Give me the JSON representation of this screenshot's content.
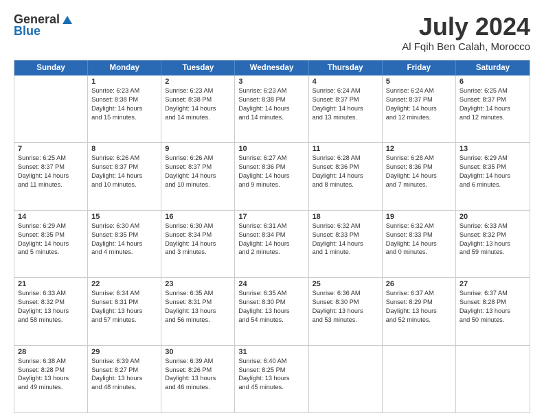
{
  "header": {
    "logo_general": "General",
    "logo_blue": "Blue",
    "title": "July 2024",
    "location": "Al Fqih Ben Calah, Morocco"
  },
  "calendar": {
    "days_of_week": [
      "Sunday",
      "Monday",
      "Tuesday",
      "Wednesday",
      "Thursday",
      "Friday",
      "Saturday"
    ],
    "rows": [
      [
        {
          "day": "",
          "text": ""
        },
        {
          "day": "1",
          "text": "Sunrise: 6:23 AM\nSunset: 8:38 PM\nDaylight: 14 hours\nand 15 minutes."
        },
        {
          "day": "2",
          "text": "Sunrise: 6:23 AM\nSunset: 8:38 PM\nDaylight: 14 hours\nand 14 minutes."
        },
        {
          "day": "3",
          "text": "Sunrise: 6:23 AM\nSunset: 8:38 PM\nDaylight: 14 hours\nand 14 minutes."
        },
        {
          "day": "4",
          "text": "Sunrise: 6:24 AM\nSunset: 8:37 PM\nDaylight: 14 hours\nand 13 minutes."
        },
        {
          "day": "5",
          "text": "Sunrise: 6:24 AM\nSunset: 8:37 PM\nDaylight: 14 hours\nand 12 minutes."
        },
        {
          "day": "6",
          "text": "Sunrise: 6:25 AM\nSunset: 8:37 PM\nDaylight: 14 hours\nand 12 minutes."
        }
      ],
      [
        {
          "day": "7",
          "text": "Sunrise: 6:25 AM\nSunset: 8:37 PM\nDaylight: 14 hours\nand 11 minutes."
        },
        {
          "day": "8",
          "text": "Sunrise: 6:26 AM\nSunset: 8:37 PM\nDaylight: 14 hours\nand 10 minutes."
        },
        {
          "day": "9",
          "text": "Sunrise: 6:26 AM\nSunset: 8:37 PM\nDaylight: 14 hours\nand 10 minutes."
        },
        {
          "day": "10",
          "text": "Sunrise: 6:27 AM\nSunset: 8:36 PM\nDaylight: 14 hours\nand 9 minutes."
        },
        {
          "day": "11",
          "text": "Sunrise: 6:28 AM\nSunset: 8:36 PM\nDaylight: 14 hours\nand 8 minutes."
        },
        {
          "day": "12",
          "text": "Sunrise: 6:28 AM\nSunset: 8:36 PM\nDaylight: 14 hours\nand 7 minutes."
        },
        {
          "day": "13",
          "text": "Sunrise: 6:29 AM\nSunset: 8:35 PM\nDaylight: 14 hours\nand 6 minutes."
        }
      ],
      [
        {
          "day": "14",
          "text": "Sunrise: 6:29 AM\nSunset: 8:35 PM\nDaylight: 14 hours\nand 5 minutes."
        },
        {
          "day": "15",
          "text": "Sunrise: 6:30 AM\nSunset: 8:35 PM\nDaylight: 14 hours\nand 4 minutes."
        },
        {
          "day": "16",
          "text": "Sunrise: 6:30 AM\nSunset: 8:34 PM\nDaylight: 14 hours\nand 3 minutes."
        },
        {
          "day": "17",
          "text": "Sunrise: 6:31 AM\nSunset: 8:34 PM\nDaylight: 14 hours\nand 2 minutes."
        },
        {
          "day": "18",
          "text": "Sunrise: 6:32 AM\nSunset: 8:33 PM\nDaylight: 14 hours\nand 1 minute."
        },
        {
          "day": "19",
          "text": "Sunrise: 6:32 AM\nSunset: 8:33 PM\nDaylight: 14 hours\nand 0 minutes."
        },
        {
          "day": "20",
          "text": "Sunrise: 6:33 AM\nSunset: 8:32 PM\nDaylight: 13 hours\nand 59 minutes."
        }
      ],
      [
        {
          "day": "21",
          "text": "Sunrise: 6:33 AM\nSunset: 8:32 PM\nDaylight: 13 hours\nand 58 minutes."
        },
        {
          "day": "22",
          "text": "Sunrise: 6:34 AM\nSunset: 8:31 PM\nDaylight: 13 hours\nand 57 minutes."
        },
        {
          "day": "23",
          "text": "Sunrise: 6:35 AM\nSunset: 8:31 PM\nDaylight: 13 hours\nand 56 minutes."
        },
        {
          "day": "24",
          "text": "Sunrise: 6:35 AM\nSunset: 8:30 PM\nDaylight: 13 hours\nand 54 minutes."
        },
        {
          "day": "25",
          "text": "Sunrise: 6:36 AM\nSunset: 8:30 PM\nDaylight: 13 hours\nand 53 minutes."
        },
        {
          "day": "26",
          "text": "Sunrise: 6:37 AM\nSunset: 8:29 PM\nDaylight: 13 hours\nand 52 minutes."
        },
        {
          "day": "27",
          "text": "Sunrise: 6:37 AM\nSunset: 8:28 PM\nDaylight: 13 hours\nand 50 minutes."
        }
      ],
      [
        {
          "day": "28",
          "text": "Sunrise: 6:38 AM\nSunset: 8:28 PM\nDaylight: 13 hours\nand 49 minutes."
        },
        {
          "day": "29",
          "text": "Sunrise: 6:39 AM\nSunset: 8:27 PM\nDaylight: 13 hours\nand 48 minutes."
        },
        {
          "day": "30",
          "text": "Sunrise: 6:39 AM\nSunset: 8:26 PM\nDaylight: 13 hours\nand 46 minutes."
        },
        {
          "day": "31",
          "text": "Sunrise: 6:40 AM\nSunset: 8:25 PM\nDaylight: 13 hours\nand 45 minutes."
        },
        {
          "day": "",
          "text": ""
        },
        {
          "day": "",
          "text": ""
        },
        {
          "day": "",
          "text": ""
        }
      ]
    ]
  }
}
